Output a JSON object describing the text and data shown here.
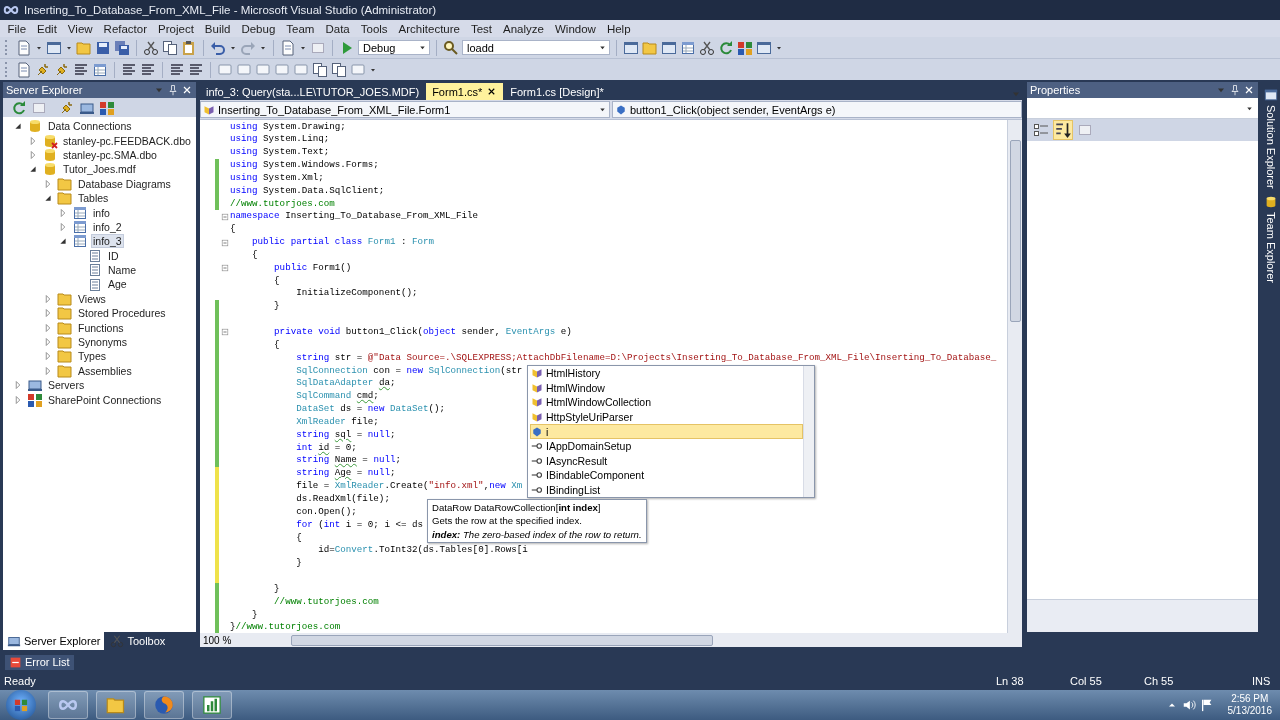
{
  "window": {
    "title": "Inserting_To_Database_From_XML_File - Microsoft Visual Studio (Administrator)"
  },
  "menu": [
    "File",
    "Edit",
    "View",
    "Refactor",
    "Project",
    "Build",
    "Debug",
    "Team",
    "Data",
    "Tools",
    "Architecture",
    "Test",
    "Analyze",
    "Window",
    "Help"
  ],
  "toolbar": {
    "configuration": "Debug",
    "find": "loadd"
  },
  "server_explorer": {
    "title": "Server Explorer",
    "tree": [
      {
        "label": "Data Connections",
        "kind": "database",
        "expanded": true,
        "selected": false,
        "children": [
          {
            "label": "stanley-pc.FEEDBACK.dbo",
            "kind": "database-error",
            "expanded": false,
            "selected": false
          },
          {
            "label": "stanley-pc.SMA.dbo",
            "kind": "database",
            "expanded": false,
            "selected": false
          },
          {
            "label": "Tutor_Joes.mdf",
            "kind": "database",
            "expanded": true,
            "selected": false,
            "children": [
              {
                "label": "Database Diagrams",
                "kind": "folder",
                "expanded": false,
                "selected": false
              },
              {
                "label": "Tables",
                "kind": "folder",
                "expanded": true,
                "selected": false,
                "children": [
                  {
                    "label": "info",
                    "kind": "table",
                    "expanded": false,
                    "selected": false
                  },
                  {
                    "label": "info_2",
                    "kind": "table",
                    "expanded": false,
                    "selected": false
                  },
                  {
                    "label": "info_3",
                    "kind": "table",
                    "expanded": true,
                    "selected": true,
                    "children": [
                      {
                        "label": "ID",
                        "kind": "column",
                        "selected": false
                      },
                      {
                        "label": "Name",
                        "kind": "column",
                        "selected": false
                      },
                      {
                        "label": "Age",
                        "kind": "column",
                        "selected": false
                      }
                    ]
                  }
                ]
              },
              {
                "label": "Views",
                "kind": "folder",
                "expanded": false,
                "selected": false
              },
              {
                "label": "Stored Procedures",
                "kind": "folder",
                "expanded": false,
                "selected": false
              },
              {
                "label": "Functions",
                "kind": "folder",
                "expanded": false,
                "selected": false
              },
              {
                "label": "Synonyms",
                "kind": "folder",
                "expanded": false,
                "selected": false
              },
              {
                "label": "Types",
                "kind": "folder",
                "expanded": false,
                "selected": false
              },
              {
                "label": "Assemblies",
                "kind": "folder",
                "expanded": false,
                "selected": false
              }
            ]
          }
        ]
      },
      {
        "label": "Servers",
        "kind": "server",
        "expanded": false,
        "selected": false
      },
      {
        "label": "SharePoint Connections",
        "kind": "network",
        "expanded": false,
        "selected": false
      }
    ]
  },
  "bottom_tabs": [
    {
      "label": "Server Explorer",
      "selected": true
    },
    {
      "label": "Toolbox",
      "selected": false
    }
  ],
  "document_tabs": [
    {
      "label": "info_3: Query(sta...LE\\TUTOR_JOES.MDF)",
      "selected": false
    },
    {
      "label": "Form1.cs*",
      "selected": true
    },
    {
      "label": "Form1.cs [Design]*",
      "selected": false
    }
  ],
  "navigation": {
    "type": "Inserting_To_Database_From_XML_File.Form1",
    "member": "button1_Click(object sender, EventArgs e)"
  },
  "code_lines": [
    {
      "changed": false,
      "fold": false,
      "tokens": [
        {
          "kind": "keyword",
          "text": "using"
        },
        {
          "kind": "plain",
          "text": " System.Drawing;"
        }
      ]
    },
    {
      "changed": false,
      "fold": false,
      "tokens": [
        {
          "kind": "keyword",
          "text": "using"
        },
        {
          "kind": "plain",
          "text": " System.Linq;"
        }
      ]
    },
    {
      "changed": false,
      "fold": false,
      "tokens": [
        {
          "kind": "keyword",
          "text": "using"
        },
        {
          "kind": "plain",
          "text": " System.Text;"
        }
      ]
    },
    {
      "changed": true,
      "saved": true,
      "fold": false,
      "tokens": [
        {
          "kind": "keyword",
          "text": "using"
        },
        {
          "kind": "plain",
          "text": " System.Windows.Forms;"
        }
      ]
    },
    {
      "changed": true,
      "saved": true,
      "fold": false,
      "tokens": [
        {
          "kind": "keyword",
          "text": "using"
        },
        {
          "kind": "plain",
          "text": " System.Xml;"
        }
      ]
    },
    {
      "changed": true,
      "saved": true,
      "fold": false,
      "tokens": [
        {
          "kind": "keyword",
          "text": "using"
        },
        {
          "kind": "plain",
          "text": " System.Data.SqlClient;"
        }
      ]
    },
    {
      "changed": true,
      "saved": true,
      "fold": false,
      "tokens": [
        {
          "kind": "comment",
          "text": "//www.tutorjoes.com"
        }
      ]
    },
    {
      "changed": false,
      "fold": true,
      "tokens": [
        {
          "kind": "keyword",
          "text": "namespace"
        },
        {
          "kind": "plain",
          "text": " Inserting_To_Database_From_XML_File"
        }
      ]
    },
    {
      "changed": false,
      "fold": false,
      "tokens": [
        {
          "kind": "plain",
          "text": "{"
        }
      ]
    },
    {
      "changed": false,
      "fold": true,
      "tokens": [
        {
          "kind": "keyword",
          "text": "    public partial class "
        },
        {
          "kind": "type",
          "text": "Form1"
        },
        {
          "kind": "plain",
          "text": " : "
        },
        {
          "kind": "type",
          "text": "Form"
        }
      ]
    },
    {
      "changed": false,
      "fold": false,
      "tokens": [
        {
          "kind": "plain",
          "text": "    {"
        }
      ]
    },
    {
      "changed": false,
      "fold": true,
      "tokens": [
        {
          "kind": "keyword",
          "text": "        public"
        },
        {
          "kind": "plain",
          "text": " Form1()"
        }
      ]
    },
    {
      "changed": false,
      "fold": false,
      "tokens": [
        {
          "kind": "plain",
          "text": "        {"
        }
      ]
    },
    {
      "changed": false,
      "fold": false,
      "tokens": [
        {
          "kind": "plain",
          "text": "            InitializeComponent();"
        }
      ]
    },
    {
      "changed": true,
      "saved": true,
      "fold": false,
      "tokens": [
        {
          "kind": "plain",
          "text": "        }"
        }
      ]
    },
    {
      "changed": true,
      "saved": true,
      "fold": false
    },
    {
      "changed": true,
      "saved": true,
      "fold": true,
      "tokens": [
        {
          "kind": "keyword",
          "text": "        private void"
        },
        {
          "kind": "plain",
          "text": " button1_Click("
        },
        {
          "kind": "keyword",
          "text": "object"
        },
        {
          "kind": "plain",
          "text": " sender, "
        },
        {
          "kind": "type",
          "text": "EventArgs"
        },
        {
          "kind": "plain",
          "text": " e)"
        }
      ]
    },
    {
      "changed": true,
      "saved": true,
      "fold": false,
      "tokens": [
        {
          "kind": "plain",
          "text": "        {"
        }
      ]
    },
    {
      "changed": true,
      "saved": true,
      "fold": false,
      "tokens": [
        {
          "kind": "keyword",
          "text": "            string"
        },
        {
          "kind": "plain",
          "text": " str = "
        },
        {
          "kind": "string",
          "text": "@\"Data Source=.\\SQLEXPRESS;AttachDbFilename=D:\\Projects\\Inserting_To_Database_From_XML_File\\Inserting_To_Database_"
        }
      ]
    },
    {
      "changed": true,
      "saved": true,
      "fold": false,
      "tokens": [
        {
          "kind": "type",
          "text": "            SqlConnection"
        },
        {
          "kind": "plain",
          "text": " con = "
        },
        {
          "kind": "keyword",
          "text": "new "
        },
        {
          "kind": "type",
          "text": "SqlConnection"
        },
        {
          "kind": "plain",
          "text": "(str"
        }
      ]
    },
    {
      "changed": true,
      "saved": true,
      "fold": false,
      "tokens": [
        {
          "kind": "type",
          "text": "            SqlDataAdapter "
        },
        {
          "kind": "warning",
          "text": "da"
        },
        {
          "kind": "plain",
          "text": ";"
        }
      ]
    },
    {
      "changed": true,
      "saved": true,
      "fold": false,
      "tokens": [
        {
          "kind": "type",
          "text": "            SqlCommand "
        },
        {
          "kind": "warning",
          "text": "cmd"
        },
        {
          "kind": "plain",
          "text": ";"
        }
      ]
    },
    {
      "changed": true,
      "saved": true,
      "fold": false,
      "tokens": [
        {
          "kind": "type",
          "text": "            DataSet"
        },
        {
          "kind": "plain",
          "text": " ds = "
        },
        {
          "kind": "keyword",
          "text": "new "
        },
        {
          "kind": "type",
          "text": "DataSet"
        },
        {
          "kind": "plain",
          "text": "();"
        }
      ]
    },
    {
      "changed": true,
      "saved": true,
      "fold": false,
      "tokens": [
        {
          "kind": "type",
          "text": "            XmlReader"
        },
        {
          "kind": "plain",
          "text": " file;"
        }
      ]
    },
    {
      "changed": true,
      "saved": true,
      "fold": false,
      "tokens": [
        {
          "kind": "keyword",
          "text": "            string "
        },
        {
          "kind": "warning",
          "text": "sql"
        },
        {
          "kind": "plain",
          "text": " = "
        },
        {
          "kind": "keyword",
          "text": "null"
        },
        {
          "kind": "plain",
          "text": ";"
        }
      ]
    },
    {
      "changed": true,
      "saved": true,
      "fold": false,
      "tokens": [
        {
          "kind": "keyword",
          "text": "            int "
        },
        {
          "kind": "warning",
          "text": "id"
        },
        {
          "kind": "plain",
          "text": " = 0;"
        }
      ]
    },
    {
      "changed": true,
      "saved": true,
      "fold": false,
      "tokens": [
        {
          "kind": "keyword",
          "text": "            string "
        },
        {
          "kind": "warning",
          "text": "Name"
        },
        {
          "kind": "plain",
          "text": " = "
        },
        {
          "kind": "keyword",
          "text": "null"
        },
        {
          "kind": "plain",
          "text": ";"
        }
      ]
    },
    {
      "changed": true,
      "saved": false,
      "fold": false,
      "tokens": [
        {
          "kind": "keyword",
          "text": "            string "
        },
        {
          "kind": "warning",
          "text": "Age"
        },
        {
          "kind": "plain",
          "text": " = "
        },
        {
          "kind": "keyword",
          "text": "null"
        },
        {
          "kind": "plain",
          "text": ";"
        }
      ]
    },
    {
      "changed": true,
      "saved": false,
      "fold": false,
      "tokens": [
        {
          "kind": "plain",
          "text": "            file = "
        },
        {
          "kind": "type",
          "text": "XmlReader"
        },
        {
          "kind": "plain",
          "text": ".Create("
        },
        {
          "kind": "string",
          "text": "\"info.xml\""
        },
        {
          "kind": "plain",
          "text": ","
        },
        {
          "kind": "keyword",
          "text": "new "
        },
        {
          "kind": "type",
          "text": "Xm"
        }
      ]
    },
    {
      "changed": true,
      "saved": false,
      "fold": false,
      "tokens": [
        {
          "kind": "plain",
          "text": "            ds.ReadXml(file);"
        }
      ]
    },
    {
      "changed": true,
      "saved": false,
      "fold": false,
      "tokens": [
        {
          "kind": "plain",
          "text": "            con.Open();"
        }
      ]
    },
    {
      "changed": true,
      "saved": false,
      "fold": false,
      "tokens": [
        {
          "kind": "keyword",
          "text": "            for"
        },
        {
          "kind": "plain",
          "text": " ("
        },
        {
          "kind": "keyword",
          "text": "int"
        },
        {
          "kind": "plain",
          "text": " i = 0; i <= ds"
        }
      ]
    },
    {
      "changed": true,
      "saved": false,
      "fold": false,
      "tokens": [
        {
          "kind": "plain",
          "text": "            {"
        }
      ]
    },
    {
      "changed": true,
      "saved": false,
      "fold": false,
      "tokens": [
        {
          "kind": "plain",
          "text": "                id="
        },
        {
          "kind": "type",
          "text": "Convert"
        },
        {
          "kind": "plain",
          "text": ".ToInt32(ds.Tables[0].Rows[i"
        }
      ]
    },
    {
      "changed": true,
      "saved": false,
      "fold": false,
      "tokens": [
        {
          "kind": "plain",
          "text": "            }"
        }
      ]
    },
    {
      "changed": true,
      "saved": false,
      "fold": false
    },
    {
      "changed": true,
      "saved": true,
      "fold": false,
      "tokens": [
        {
          "kind": "plain",
          "text": "        }"
        }
      ]
    },
    {
      "changed": true,
      "saved": true,
      "fold": false,
      "tokens": [
        {
          "kind": "comment",
          "text": "        //www.tutorjoes.com"
        }
      ]
    },
    {
      "changed": true,
      "saved": true,
      "fold": false,
      "tokens": [
        {
          "kind": "plain",
          "text": "    }"
        }
      ]
    },
    {
      "changed": true,
      "saved": true,
      "fold": false,
      "tokens": [
        {
          "kind": "plain",
          "text": "}"
        },
        {
          "kind": "comment",
          "text": "//www.tutorjoes.com"
        }
      ]
    }
  ],
  "zoom": "100 %",
  "completion": {
    "items": [
      {
        "label": "HtmlHistory",
        "kind": "class",
        "selected": false
      },
      {
        "label": "HtmlWindow",
        "kind": "class",
        "selected": false
      },
      {
        "label": "HtmlWindowCollection",
        "kind": "class",
        "selected": false
      },
      {
        "label": "HttpStyleUriParser",
        "kind": "class",
        "selected": false
      },
      {
        "label": "i",
        "kind": "keyword",
        "selected": true
      },
      {
        "label": "IAppDomainSetup",
        "kind": "interface",
        "selected": false
      },
      {
        "label": "IAsyncResult",
        "kind": "interface",
        "selected": false
      },
      {
        "label": "IBindableComponent",
        "kind": "interface",
        "selected": false
      },
      {
        "label": "IBindingList",
        "kind": "interface",
        "selected": false
      }
    ]
  },
  "tooltip": {
    "signature": "DataRow DataRowCollection[**int index**]",
    "summary": "Gets the row at the specified index.",
    "parameter": "**index:** The zero-based index of the row to return."
  },
  "properties": {
    "title": "Properties"
  },
  "side_tabs": [
    "Solution Explorer",
    "Team Explorer"
  ],
  "error_list": "Error List",
  "status": {
    "message": "Ready",
    "line": "Ln 38",
    "column": "Col 55",
    "char": "Ch 55",
    "mode": "INS"
  },
  "clock": {
    "time": "2:56 PM",
    "date": "5/13/2016"
  }
}
